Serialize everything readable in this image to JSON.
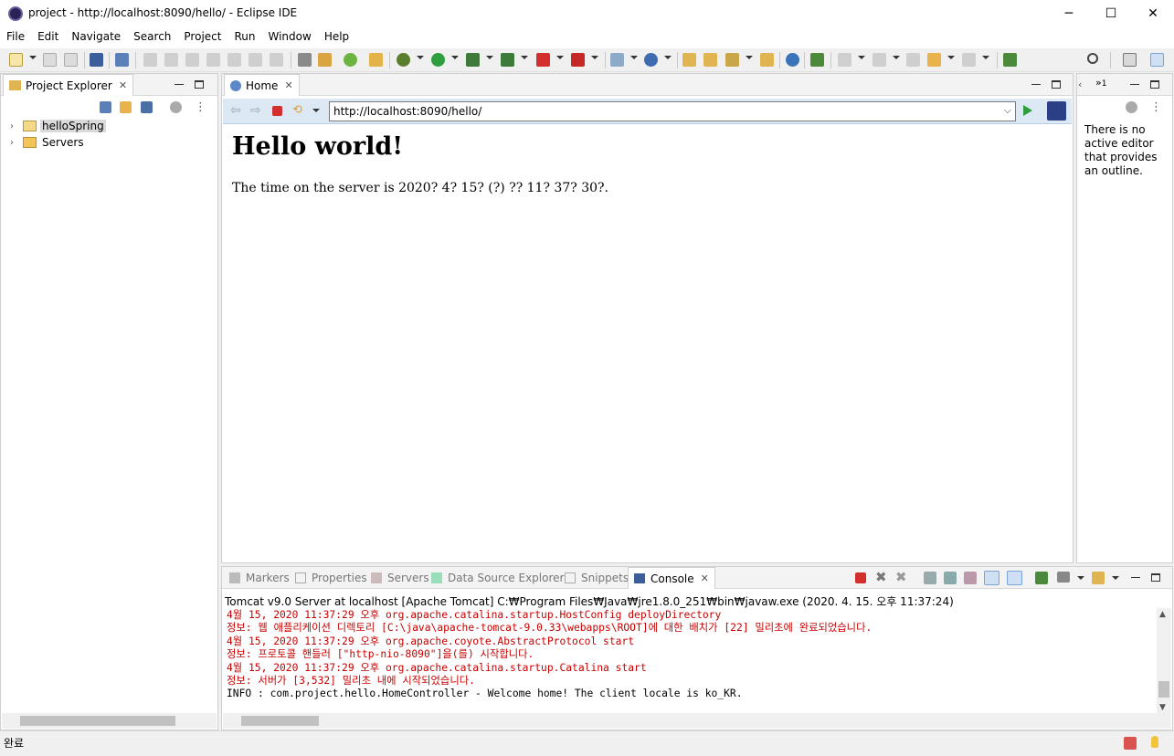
{
  "window": {
    "title": "project - http://localhost:8090/hello/ - Eclipse IDE",
    "controls": {
      "minimize": "─",
      "maximize": "☐",
      "close": "✕"
    }
  },
  "menu": [
    "File",
    "Edit",
    "Navigate",
    "Search",
    "Project",
    "Run",
    "Window",
    "Help"
  ],
  "project_explorer": {
    "tab_label": "Project Explorer",
    "tree": [
      {
        "label": "helloSpring",
        "selected": true,
        "icon": "spring-project-icon"
      },
      {
        "label": "Servers",
        "selected": false,
        "icon": "folder-icon"
      }
    ]
  },
  "browser": {
    "tab_label": "Home",
    "url": "http://localhost:8090/hello/",
    "heading": "Hello world!",
    "paragraph": "The time on the server is 2020? 4? 15? (?) ?? 11? 37? 30?."
  },
  "outline": {
    "tab_count": "1",
    "message": "There is no active editor that provides an outline."
  },
  "bottom_tabs": [
    "Markers",
    "Properties",
    "Servers",
    "Data Source Explorer",
    "Snippets",
    "Console"
  ],
  "console": {
    "description": "Tomcat v9.0 Server at localhost [Apache Tomcat] C:₩Program Files₩Java₩jre1.8.0_251₩bin₩javaw.exe  (2020. 4. 15. 오후 11:37:24)",
    "lines": [
      "4월 15, 2020 11:37:29 오후 org.apache.catalina.startup.HostConfig deployDirectory",
      "정보: 웹 애플리케이션 디렉토리 [C:\\java\\apache-tomcat-9.0.33\\webapps\\ROOT]에 대한 배치가 [22] 밀리초에 완료되었습니다.",
      "4월 15, 2020 11:37:29 오후 org.apache.coyote.AbstractProtocol start",
      "정보: 프로토콜 핸들러 [\"http-nio-8090\"]을(를) 시작합니다.",
      "4월 15, 2020 11:37:29 오후 org.apache.catalina.startup.Catalina start",
      "정보: 서버가 [3,532] 밀리초 내에 시작되었습니다.",
      "INFO : com.project.hello.HomeController - Welcome home! The client locale is ko_KR."
    ],
    "line_colors": [
      "red",
      "red",
      "red",
      "red",
      "red",
      "red",
      "black"
    ]
  },
  "status": {
    "text": "완료"
  },
  "colors": {
    "log_red": "#c80000",
    "accent_blue": "#dce8f4",
    "selection": "#dadada"
  }
}
